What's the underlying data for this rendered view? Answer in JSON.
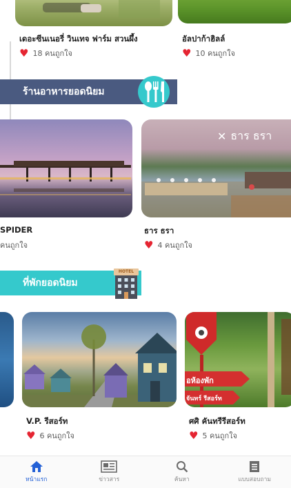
{
  "row1": {
    "cards": [
      {
        "title": "เดอะซีนเนอรี่ วินเทจ ฟาร์ม สวนผึ้ง",
        "likes": "18 คนถูกใจ"
      },
      {
        "title": "อัลปาก้าฮิลล์",
        "likes": "10 คนถูกใจ"
      }
    ]
  },
  "restaurants": {
    "section_title": "ร้านอาหารยอดนิยม",
    "cards": [
      {
        "title": "SPIDER",
        "likes": "คนถูกใจ"
      },
      {
        "title": "ธาร ธรา",
        "likes": "4 คนถูกใจ",
        "image_text": "ธาร ธรา"
      }
    ]
  },
  "hotels": {
    "section_title": "ที่พักยอดนิยม",
    "icon_text": "HOTEL",
    "cards": [
      {
        "title": "V.P. รีสอร์ท",
        "likes": "6 คนถูกใจ"
      },
      {
        "title": "ศศิ คันทรีรีสอร์ท",
        "likes": "5 คนถูกใจ",
        "image_text_1": "อห้องพัก",
        "image_text_2": "จันทร์ รีสอร์ท"
      }
    ]
  },
  "tabbar": {
    "tabs": [
      {
        "label": "หน้าแรก",
        "icon": "home-icon",
        "active": true
      },
      {
        "label": "ข่าวสาร",
        "icon": "news-icon",
        "active": false
      },
      {
        "label": "ค้นหา",
        "icon": "search-icon",
        "active": false
      },
      {
        "label": "แบบสอบถาม",
        "icon": "survey-icon",
        "active": false
      }
    ]
  },
  "colors": {
    "accent": "#2461d6",
    "heart": "#e52532",
    "restaurant_banner": "#4a5a80",
    "hotel_banner": "#35c9cc"
  }
}
